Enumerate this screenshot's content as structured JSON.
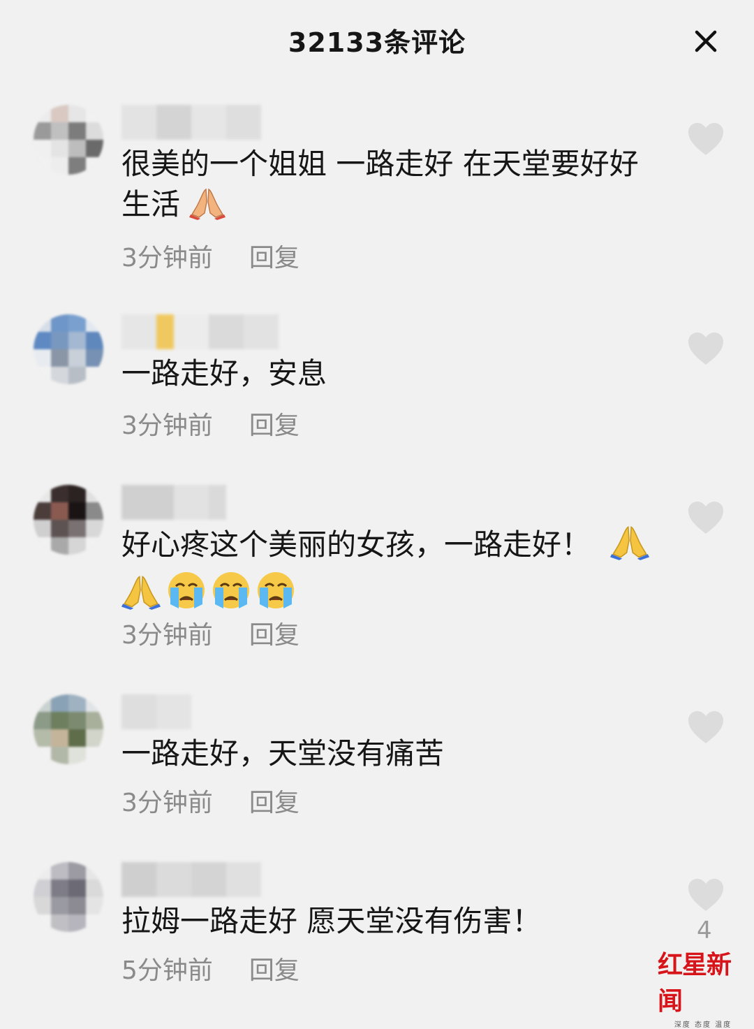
{
  "header": {
    "title": "32133条评论",
    "close_icon": "close-icon"
  },
  "comments": [
    {
      "text": "很美的一个姐姐 一路走好 在天堂要好好生活",
      "time": "3分钟前",
      "reply": "回复"
    },
    {
      "text": "一路走好，安息",
      "time": "3分钟前",
      "reply": "回复"
    },
    {
      "text": "好心疼这个美丽的女孩，一路走好！",
      "time": "3分钟前",
      "reply": "回复"
    },
    {
      "text": "一路走好，天堂没有痛苦",
      "time": "3分钟前",
      "reply": "回复"
    },
    {
      "text": "拉姆一路走好 愿天堂没有伤害！",
      "time": "5分钟前",
      "reply": "回复"
    }
  ],
  "last_like_count": "4",
  "watermark": {
    "brand": "红星新闻",
    "tagline": "深度 态度 温度"
  },
  "colors": {
    "background": "#f1f1f1",
    "meta": "#8a8a8a",
    "heart": "#dcdcdc",
    "brand": "#d8141b"
  }
}
